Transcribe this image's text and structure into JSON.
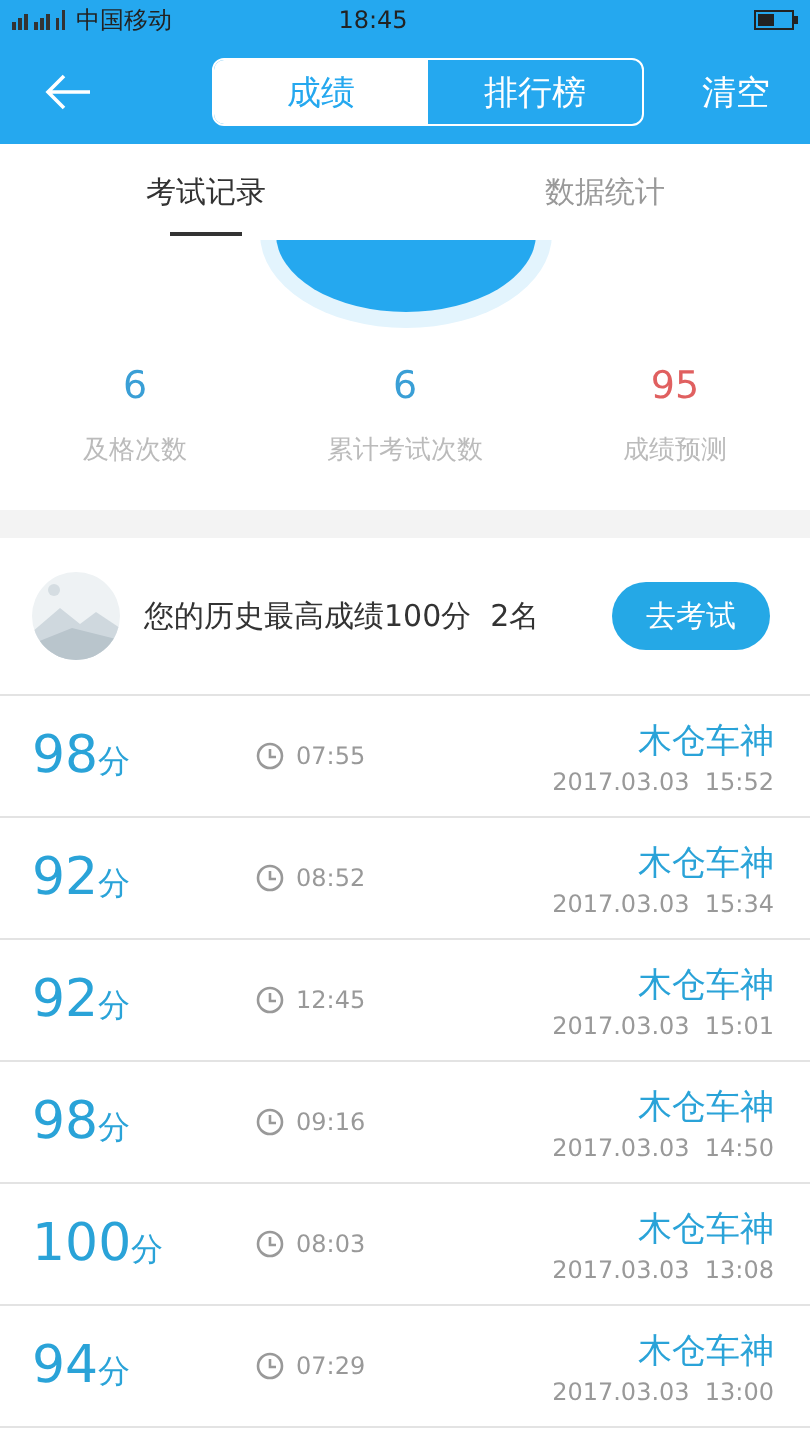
{
  "status_bar": {
    "carrier": "中国移动",
    "time": "18:45"
  },
  "header": {
    "segments": [
      {
        "label": "成绩",
        "selected": true
      },
      {
        "label": "排行榜",
        "selected": false
      }
    ],
    "action": "清空"
  },
  "tabs": [
    {
      "label": "考试记录",
      "selected": true
    },
    {
      "label": "数据统计",
      "selected": false
    }
  ],
  "stats": [
    {
      "value": "6",
      "label": "及格次数",
      "color": "#3a9fd6"
    },
    {
      "value": "6",
      "label": "累计考试次数",
      "color": "#3a9fd6"
    },
    {
      "value": "95",
      "label": "成绩预测",
      "color": "#e06060"
    }
  ],
  "best": {
    "text": "您的历史最高成绩100分  2名",
    "button": "去考试"
  },
  "records": [
    {
      "score": "98",
      "unit": "分",
      "duration": "07:55",
      "name": "木仓车神",
      "date": "2017.03.03  15:52"
    },
    {
      "score": "92",
      "unit": "分",
      "duration": "08:52",
      "name": "木仓车神",
      "date": "2017.03.03  15:34"
    },
    {
      "score": "92",
      "unit": "分",
      "duration": "12:45",
      "name": "木仓车神",
      "date": "2017.03.03  15:01"
    },
    {
      "score": "98",
      "unit": "分",
      "duration": "09:16",
      "name": "木仓车神",
      "date": "2017.03.03  14:50"
    },
    {
      "score": "100",
      "unit": "分",
      "duration": "08:03",
      "name": "木仓车神",
      "date": "2017.03.03  13:08"
    },
    {
      "score": "94",
      "unit": "分",
      "duration": "07:29",
      "name": "木仓车神",
      "date": "2017.03.03  13:00"
    }
  ]
}
